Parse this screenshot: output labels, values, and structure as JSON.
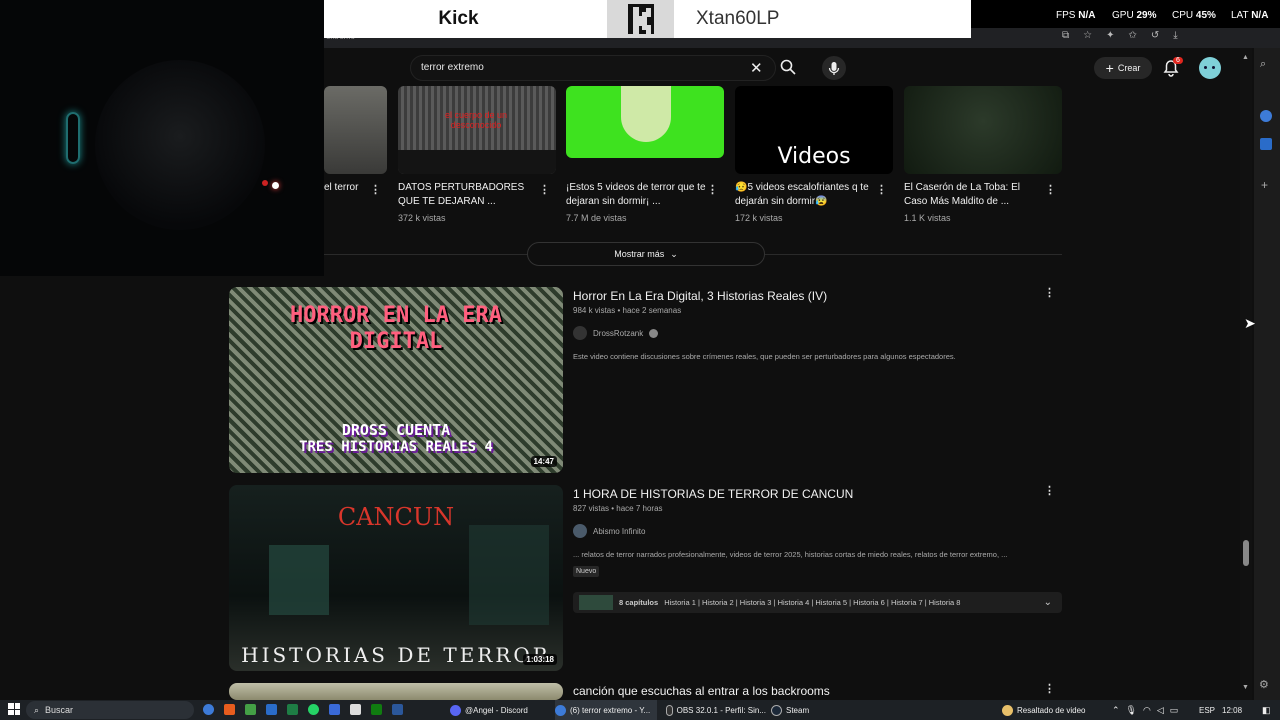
{
  "overlay": {
    "kick_label": "Kick",
    "kick_logo": "K",
    "username": "Xtan60LP",
    "stats": {
      "fps_label": "FPS",
      "fps_value": "N/A",
      "gpu_label": "GPU",
      "gpu_value": "29%",
      "cpu_label": "CPU",
      "cpu_value": "45%",
      "lat_label": "LAT",
      "lat_value": "N/A"
    }
  },
  "browser": {
    "tab_fragment": "extremo"
  },
  "header": {
    "search_value": "terror extremo",
    "create_label": "Crear",
    "notification_count": "6"
  },
  "shelf": {
    "items": [
      {
        "title": "el terror",
        "views": "",
        "thumb_text": ""
      },
      {
        "title": "DATOS PERTURBADORES QUE TE DEJARAN ...",
        "views": "372 k vistas",
        "thumb_text": "el cuerpo de un desconocido"
      },
      {
        "title": "¡Estos 5 videos de terror que te dejaran sin dormir¡ ...",
        "views": "7.7 M de vistas",
        "thumb_text": ""
      },
      {
        "title": "😥5 videos escalofriantes q te dejarán sin dormir😰",
        "views": "172 k vistas",
        "thumb_text": "Videos"
      },
      {
        "title": "El Caserón de La Toba: El Caso Más Maldito de ...",
        "views": "1.1 K vistas",
        "thumb_text": ""
      }
    ],
    "show_more": "Mostrar más"
  },
  "results": [
    {
      "title": "Horror En La Era Digital, 3 Historias Reales (IV)",
      "meta": "984 k vistas • hace 2 semanas",
      "channel": "DrossRotzank",
      "description": "Este video contiene discusiones sobre crímenes reales, que pueden ser perturbadores para algunos espectadores.",
      "duration": "14:47",
      "thumb_top": "HORROR EN LA ERA DIGITAL",
      "thumb_bottom_1": "DROSS CUENTA",
      "thumb_bottom_2": "TRES HISTORIAS REALES 4"
    },
    {
      "title": "1 HORA DE HISTORIAS DE TERROR DE CANCUN",
      "meta": "827 vistas • hace 7 horas",
      "channel": "Abismo Infinito",
      "description": "... relatos de terror narrados profesionalmente, videos de terror 2025, historias cortas de miedo reales, relatos de terror extremo, ...",
      "badge": "Nuevo",
      "chapters_count": "8 capítulos",
      "chapters_list": "Historia 1 | Historia 2 | Historia 3 | Historia 4 | Historia 5 | Historia 6 | Historia 7 | Historia 8",
      "duration": "1:03:18",
      "thumb_top": "CANCUN",
      "thumb_bottom": "HISTORIAS DE TERROR"
    },
    {
      "title": "canción que escuchas al entrar a los backrooms"
    }
  ],
  "taskbar": {
    "search_label": "Buscar",
    "apps": [
      {
        "label": "@Angel - Discord"
      },
      {
        "label": "(6) terror extremo - Y..."
      },
      {
        "label": "OBS 32.0.1 - Perfil: Sin..."
      },
      {
        "label": "Steam"
      }
    ],
    "highlight_label": "Resaltado de video",
    "language": "ESP",
    "time": "12:08"
  }
}
